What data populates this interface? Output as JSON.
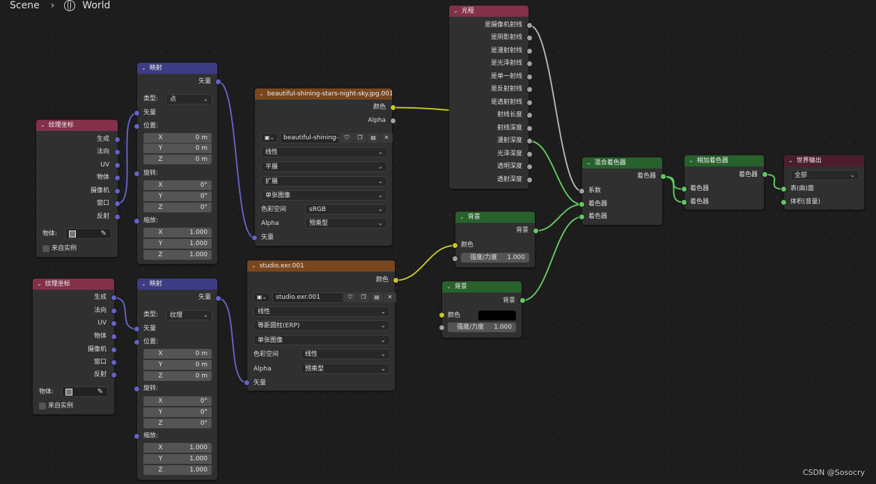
{
  "breadcrumb": {
    "scene": "Scene",
    "world": "World"
  },
  "texcoord": {
    "title": "纹理坐标",
    "outputs": [
      "生成",
      "法向",
      "UV",
      "物体",
      "摄像机",
      "窗口",
      "反射"
    ],
    "object_label": "物体:",
    "from_instance": "来自实例"
  },
  "mapping": {
    "title": "映射",
    "out_vector": "矢量",
    "type_label": "类型:",
    "in_vector": "矢量",
    "location": "位置:",
    "rotation": "旋转:",
    "scale": "缩放:",
    "axes": [
      "X",
      "Y",
      "Z"
    ],
    "loc_values": [
      "0 m",
      "0 m",
      "0 m"
    ],
    "rot_values": [
      "0°",
      "0°",
      "0°"
    ],
    "scale_values": [
      "1.000",
      "1.000",
      "1.000"
    ]
  },
  "mapping1": {
    "type": "点"
  },
  "mapping2": {
    "type": "纹理"
  },
  "img1": {
    "title": "beautiful-shining-stars-night-sky.jpg.001",
    "out_color": "颜色",
    "out_alpha": "Alpha",
    "image_name": "beautiful-shining-...",
    "interpolation": "线性",
    "projection": "平展",
    "extension": "扩展",
    "source": "单张图像",
    "colorspace_label": "色彩空间",
    "colorspace": "sRGB",
    "alpha_label": "Alpha",
    "alpha": "预乘型",
    "in_vector": "矢量"
  },
  "img2": {
    "title": "studio.exr.001",
    "out_color": "颜色",
    "image_name": "studio.exr.001",
    "interpolation": "线性",
    "projection": "等距圆柱(ERP)",
    "source": "单张图像",
    "colorspace_label": "色彩空间",
    "colorspace": "线性",
    "alpha_label": "Alpha",
    "alpha": "预乘型",
    "in_vector": "矢量"
  },
  "lightpath": {
    "title": "光程",
    "outputs": [
      "是摄像机射线",
      "是阴影射线",
      "是漫射射线",
      "是光泽射线",
      "是单一射线",
      "是反射射线",
      "是透射射线",
      "射线长度",
      "射线深度",
      "漫射深度",
      "光泽深度",
      "透明深度",
      "透射深度"
    ]
  },
  "bg1": {
    "title": "背景",
    "out": "背景",
    "color": "颜色",
    "strength_label": "强度/力度",
    "strength": "1.000"
  },
  "bg2": {
    "title": "背景",
    "out": "背景",
    "color": "颜色",
    "strength_label": "强度/力度",
    "strength": "1.000",
    "swatch": "#000000"
  },
  "mix": {
    "title": "混合着色器",
    "out": "着色器",
    "fac": "系数",
    "in1": "着色器",
    "in2": "着色器"
  },
  "add": {
    "title": "相加着色器",
    "out": "着色器",
    "in1": "着色器",
    "in2": "着色器"
  },
  "output": {
    "title": "世界输出",
    "target": "全部",
    "surface": "表(曲)面",
    "volume": "体积(音量)"
  },
  "watermark": "CSDN @Sosocry",
  "socket_colors": {
    "vector": "#6363c7",
    "color": "#c7c729",
    "float": "#a1a1a1",
    "shader": "#63c763"
  }
}
